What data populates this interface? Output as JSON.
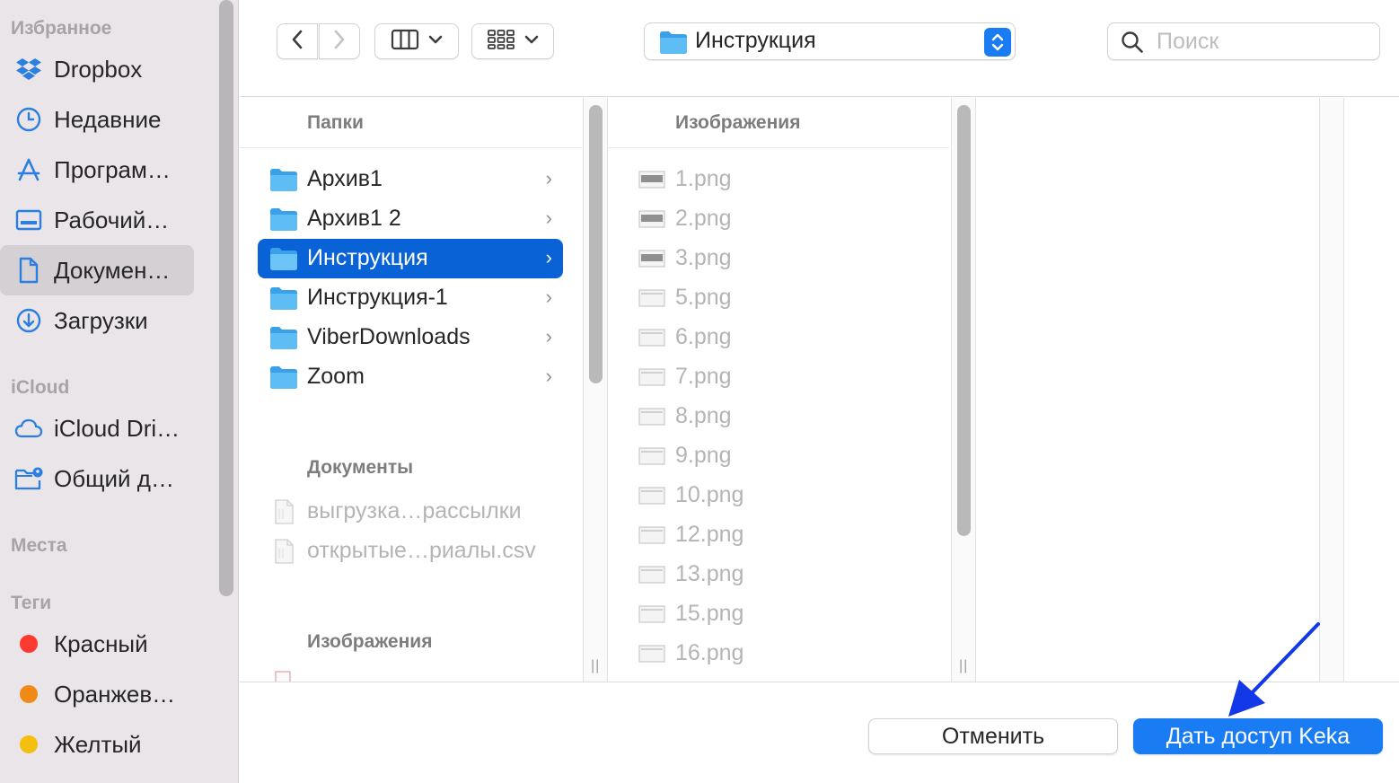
{
  "sidebar": {
    "favorites_heading": "Избранное",
    "favorites": [
      {
        "label": "Dropbox",
        "icon": "dropbox-icon"
      },
      {
        "label": "Недавние",
        "icon": "clock-icon"
      },
      {
        "label": "Програм…",
        "icon": "applications-icon"
      },
      {
        "label": "Рабочий…",
        "icon": "desktop-icon"
      },
      {
        "label": "Докумен…",
        "icon": "document-icon",
        "selected": true
      },
      {
        "label": "Загрузки",
        "icon": "download-icon"
      }
    ],
    "icloud_heading": "iCloud",
    "icloud": [
      {
        "label": "iCloud Dri…",
        "icon": "cloud-icon"
      },
      {
        "label": "Общий д…",
        "icon": "shared-folder-icon"
      }
    ],
    "places_heading": "Места",
    "tags_heading": "Теги",
    "tags": [
      {
        "label": "Красный",
        "color": "#fe3a30"
      },
      {
        "label": "Оранжев…",
        "color": "#f08a17"
      },
      {
        "label": "Желтый",
        "color": "#f3c00f"
      }
    ]
  },
  "toolbar": {
    "path_label": "Инструкция",
    "search_placeholder": "Поиск"
  },
  "column1": {
    "folders_heading": "Папки",
    "folders": [
      {
        "label": "Архив1"
      },
      {
        "label": "Архив1 2"
      },
      {
        "label": "Инструкция",
        "selected": true
      },
      {
        "label": "Инструкция-1"
      },
      {
        "label": "ViberDownloads"
      },
      {
        "label": "Zoom"
      }
    ],
    "documents_heading": "Документы",
    "documents": [
      {
        "label": "выгрузка…рассылки"
      },
      {
        "label": "открытые…риалы.csv"
      }
    ],
    "images_heading": "Изображения"
  },
  "column2": {
    "images_heading": "Изображения",
    "files": [
      "1.png",
      "2.png",
      "3.png",
      "5.png",
      "6.png",
      "7.png",
      "8.png",
      "9.png",
      "10.png",
      "12.png",
      "13.png",
      "15.png",
      "16.png"
    ]
  },
  "buttons": {
    "cancel": "Отменить",
    "confirm": "Дать доступ Keka"
  },
  "colors": {
    "accent": "#1a7cf3",
    "selection": "#0a63d6",
    "folder": "#4aaef0",
    "annotation_arrow": "#1238e8"
  }
}
